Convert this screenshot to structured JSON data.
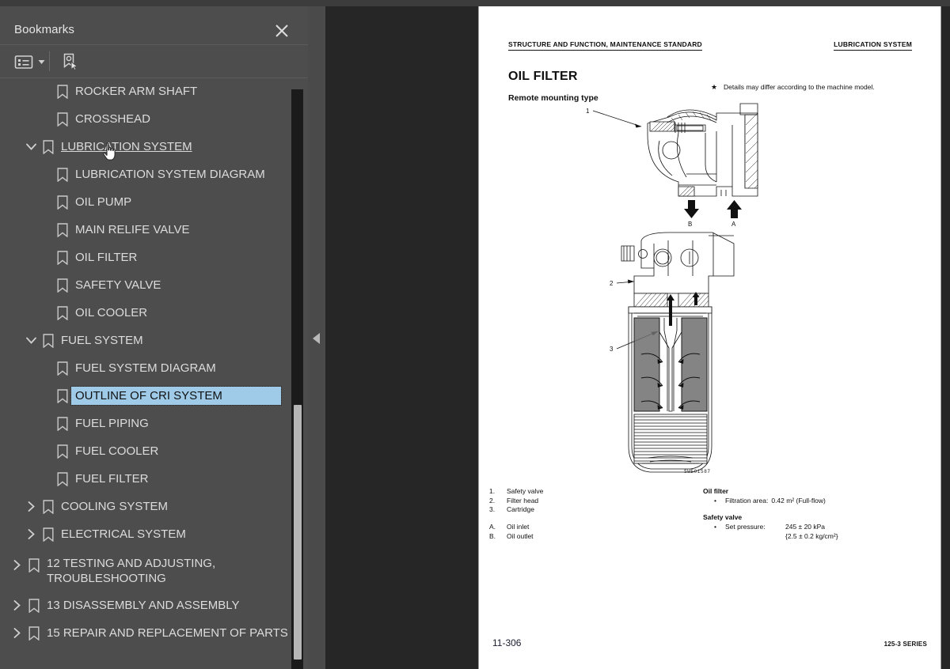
{
  "sidebar": {
    "title": "Bookmarks",
    "close_icon": "close-icon",
    "toolbar": {
      "options_icon": "bookmark-options-icon",
      "caret_icon": "chevron-down-icon",
      "find_icon": "find-current-bookmark-icon"
    },
    "items": [
      {
        "label": "ROCKER ARM SHAFT",
        "level": 2,
        "twisty": "none",
        "state": "normal"
      },
      {
        "label": "CROSSHEAD",
        "level": 2,
        "twisty": "none",
        "state": "normal"
      },
      {
        "label": "LUBRICATION SYSTEM",
        "level": 1,
        "twisty": "expanded",
        "state": "hovered"
      },
      {
        "label": "LUBRICATION SYSTEM DIAGRAM",
        "level": 2,
        "twisty": "none",
        "state": "normal"
      },
      {
        "label": "OIL PUMP",
        "level": 2,
        "twisty": "none",
        "state": "normal"
      },
      {
        "label": "MAIN RELIFE VALVE",
        "level": 2,
        "twisty": "none",
        "state": "normal"
      },
      {
        "label": "OIL FILTER",
        "level": 2,
        "twisty": "none",
        "state": "normal"
      },
      {
        "label": "SAFETY VALVE",
        "level": 2,
        "twisty": "none",
        "state": "normal"
      },
      {
        "label": "OIL COOLER",
        "level": 2,
        "twisty": "none",
        "state": "normal"
      },
      {
        "label": "FUEL SYSTEM",
        "level": 1,
        "twisty": "expanded",
        "state": "normal"
      },
      {
        "label": "FUEL SYSTEM DIAGRAM",
        "level": 2,
        "twisty": "none",
        "state": "normal"
      },
      {
        "label": "OUTLINE OF CRI SYSTEM",
        "level": 2,
        "twisty": "none",
        "state": "selected"
      },
      {
        "label": "FUEL PIPING",
        "level": 2,
        "twisty": "none",
        "state": "normal"
      },
      {
        "label": "FUEL COOLER",
        "level": 2,
        "twisty": "none",
        "state": "normal"
      },
      {
        "label": "FUEL FILTER",
        "level": 2,
        "twisty": "none",
        "state": "normal"
      },
      {
        "label": "COOLING SYSTEM",
        "level": 1,
        "twisty": "collapsed",
        "state": "normal"
      },
      {
        "label": "ELECTRICAL SYSTEM",
        "level": 1,
        "twisty": "collapsed",
        "state": "normal"
      },
      {
        "label": "12 TESTING AND ADJUSTING, TROUBLESHOOTING",
        "level": 0,
        "twisty": "collapsed",
        "state": "normal",
        "two_line": true
      },
      {
        "label": "13 DISASSEMBLY AND ASSEMBLY",
        "level": 0,
        "twisty": "collapsed",
        "state": "normal"
      },
      {
        "label": "15 REPAIR AND REPLACEMENT OF PARTS",
        "level": 0,
        "twisty": "collapsed",
        "state": "normal"
      }
    ],
    "selection_color": "#a0cbe8",
    "background_color": "#4d4d4d"
  },
  "splitter": {
    "collapse_icon": "collapse-left-triangle-icon"
  },
  "document": {
    "header_left": "STRUCTURE AND FUNCTION, MAINTENANCE STANDARD",
    "header_right": "LUBRICATION SYSTEM",
    "title": "OIL FILTER",
    "subtitle": "Remote mounting type",
    "note_marker": "★",
    "note_text": "Details may differ according to the machine model.",
    "figure_code": "SWE01587",
    "figure_callouts": [
      "1",
      "2",
      "3",
      "A",
      "B"
    ],
    "legend_numbered": [
      {
        "key": "1.",
        "text": "Safety valve"
      },
      {
        "key": "2.",
        "text": "Filter head"
      },
      {
        "key": "3.",
        "text": "Cartridge"
      }
    ],
    "legend_lettered": [
      {
        "key": "A.",
        "text": "Oil inlet"
      },
      {
        "key": "B.",
        "text": "Oil outlet"
      }
    ],
    "specs": [
      {
        "heading": "Oil filter",
        "rows": [
          {
            "bullet": "•",
            "label": "Filtration area:",
            "value": "0.42 m² (Full-flow)",
            "inline": true
          }
        ]
      },
      {
        "heading": "Safety valve",
        "rows": [
          {
            "bullet": "•",
            "label": "Set  pressure:",
            "value": "245 ± 20 kPa",
            "inline": false
          },
          {
            "bullet": "",
            "label": "",
            "value": "{2.5 ± 0.2 kg/cm²}",
            "inline": false
          }
        ]
      }
    ],
    "footer_left": "11-306",
    "footer_right": "125-3 SERIES"
  }
}
